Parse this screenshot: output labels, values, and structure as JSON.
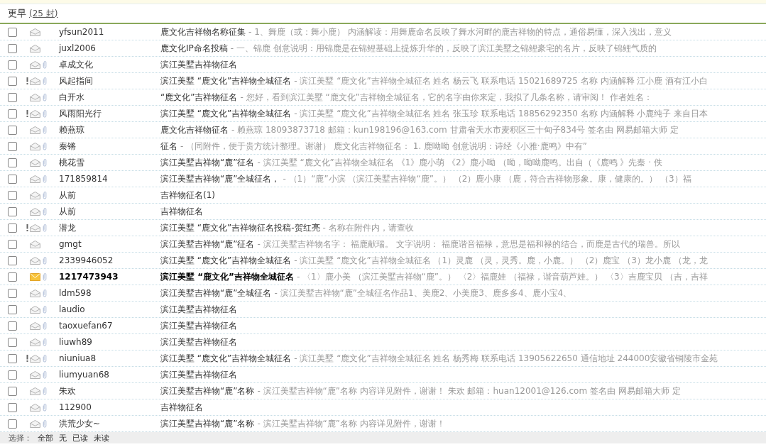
{
  "group": {
    "title": "更早",
    "count": "(25 封)"
  },
  "messages": [
    {
      "sender": "yfsun2011",
      "subject": "鹿文化吉祥物名称征集",
      "preview": "- 1、舞鹿（或：舞小鹿） 内涵解读：用舞鹿命名反映了舞水河畔的鹿吉祥物的特点，通俗易懂，深入浅出，意义",
      "checked": false,
      "flagged": false,
      "unread": false,
      "attachment": false
    },
    {
      "sender": "juxl2006",
      "subject": "鹿文化IP命名投稿",
      "preview": "- 一、锦鹿 创意说明：用锦鹿是在锦鲤基础上提炼升华的，反映了滨江美墅之锦鲤豪宅的名片，反映了锦鲤气质的",
      "checked": false,
      "flagged": false,
      "unread": false,
      "attachment": false
    },
    {
      "sender": "卓成文化",
      "subject": "滨江美墅吉祥物征名",
      "checked": false,
      "flagged": false,
      "unread": false,
      "attachment": true
    },
    {
      "sender": "风起指间",
      "subject": "滨江美墅 “鹿文化”吉祥物全城征名",
      "preview": "-  滨江美墅 “鹿文化”吉祥物全城征名 姓名 杨云飞 联系电话 15021689725 名称 内涵解释 江小鹿 酒有江小白",
      "checked": false,
      "flagged": true,
      "unread": false,
      "attachment": true
    },
    {
      "sender": "白开水",
      "subject": "“鹿文化”吉祥物征名",
      "preview": "- 您好，看到滨江美墅 “鹿文化”吉祥物全城征名，它的名字由你来定，我拟了几条名称，请审阅！ 作者姓名：",
      "checked": false,
      "flagged": false,
      "unread": false,
      "attachment": true
    },
    {
      "sender": "风雨阳光行",
      "subject": "滨江美墅 “鹿文化”吉祥物全城征名",
      "preview": "-  滨江美墅 “鹿文化”吉祥物全城征名 姓名 张玉珍 联系电话 18856292350 名称 内涵解释 小鹿纯子 来自日本",
      "checked": false,
      "flagged": true,
      "unread": false,
      "attachment": true
    },
    {
      "sender": "赖燕琼",
      "subject": "鹿文化吉祥物征名",
      "preview": "-  赖燕琼 18093873718 邮箱：kun198196@163.com 甘肃省天水市麦积区三十甸子834号 签名由 网易邮箱大师 定",
      "checked": false,
      "flagged": false,
      "unread": false,
      "attachment": true
    },
    {
      "sender": "秦锵",
      "subject": "征名",
      "preview": "- （同附件，便于贵方统计整理。谢谢） 鹿文化吉祥物征名： 1. 鹿呦呦 创意说明：诗经《小雅·鹿鸣》中有”",
      "checked": false,
      "flagged": false,
      "unread": false,
      "attachment": true
    },
    {
      "sender": "桃花雪",
      "subject": "滨江美墅吉祥物“鹿”征名",
      "preview": "- 滨江美墅 “鹿文化”吉祥物全城征名 《1》鹿小萌 《2》鹿小呦 （呦，呦呦鹿鸣。出自（《鹿鸣 》先秦 · 佚",
      "checked": false,
      "flagged": false,
      "unread": false,
      "attachment": true
    },
    {
      "sender": "171859814",
      "subject": "滨江美墅吉祥物“鹿”全城征名，",
      "preview": "- （1）“鹿”小滨 （滨江美墅吉祥物“鹿”。） （2）鹿小康 （鹿，符合吉祥物形象。康，健康的。） （3）福",
      "checked": false,
      "flagged": false,
      "unread": false,
      "attachment": true
    },
    {
      "sender": "从前",
      "subject": "吉祥物征名(1)",
      "checked": false,
      "flagged": false,
      "unread": false,
      "attachment": true
    },
    {
      "sender": "从前",
      "subject": "吉祥物征名",
      "checked": false,
      "flagged": false,
      "unread": false,
      "attachment": true
    },
    {
      "sender": "潜龙",
      "subject": "滨江美墅 “鹿文化”吉祥物征名投稿-贺红亮",
      "preview": "- 名称在附件内，请查收",
      "checked": false,
      "flagged": true,
      "unread": false,
      "attachment": true
    },
    {
      "sender": "gmgt",
      "subject": "滨江美墅吉祥物“鹿”征名",
      "preview": "- 滨江美墅吉祥物名字： 福鹿献瑞。 文字说明： 福鹿谐音福禄，意思是福和禄的结合，而鹿是古代的瑞兽。所以",
      "checked": false,
      "flagged": false,
      "unread": false,
      "attachment": false
    },
    {
      "sender": "2339946052",
      "subject": "滨江美墅 “鹿文化”吉祥物全城征名",
      "preview": "- 滨江美墅 “鹿文化”吉祥物全城征名 （1）灵鹿 （灵，灵秀。鹿，小鹿。） （2）鹿宝 （3）龙小鹿 （龙，龙",
      "checked": false,
      "flagged": false,
      "unread": false,
      "attachment": true
    },
    {
      "sender": "1217473943",
      "subject": "滨江美墅 “鹿文化”吉祥物全城征名",
      "preview": "- 〈1〉鹿小美 （滨江美墅吉祥物“鹿”。） 〈2〉福鹿娃 （福禄，谐音葫芦娃。） 〈3〉吉鹿宝贝 （吉，吉祥",
      "checked": false,
      "flagged": false,
      "unread": true,
      "attachment": true
    },
    {
      "sender": "ldm598",
      "subject": "滨江美墅吉祥物“鹿”全城征名",
      "preview": "- 滨江美墅吉祥物“鹿”全城征名作品1、美鹿2、小美鹿3、鹿多多4、鹿小宝4、",
      "checked": false,
      "flagged": false,
      "unread": false,
      "attachment": true
    },
    {
      "sender": "laudio",
      "subject": "滨江美墅吉祥物征名",
      "checked": false,
      "flagged": false,
      "unread": false,
      "attachment": true
    },
    {
      "sender": "taoxuefan67",
      "subject": "滨江美墅吉祥物征名",
      "checked": false,
      "flagged": false,
      "unread": false,
      "attachment": true
    },
    {
      "sender": "liuwh89",
      "subject": "滨江美墅吉祥物征名",
      "checked": false,
      "flagged": false,
      "unread": false,
      "attachment": true
    },
    {
      "sender": "niuniua8",
      "subject": "滨江美墅 “鹿文化”吉祥物全城征名",
      "preview": "-  滨江美墅 “鹿文化”吉祥物全城征名 姓名 杨秀梅 联系电话 13905622650 通信地址 244000安徽省铜陵市金苑",
      "checked": false,
      "flagged": true,
      "unread": false,
      "attachment": true
    },
    {
      "sender": "liumyuan68",
      "subject": "滨江美墅吉祥物征名",
      "checked": false,
      "flagged": false,
      "unread": false,
      "attachment": true
    },
    {
      "sender": "朱欢",
      "subject": "滨江美墅吉祥物“鹿”名称",
      "preview": "-  滨江美墅吉祥物“鹿”名称 内容详见附件，谢谢！ 朱欢 邮箱：huan12001@126.com 签名由 网易邮箱大师 定",
      "checked": false,
      "flagged": false,
      "unread": false,
      "attachment": true
    },
    {
      "sender": "112900",
      "subject": "吉祥物征名",
      "checked": false,
      "flagged": false,
      "unread": false,
      "attachment": true
    },
    {
      "sender": "洪荒少女~",
      "subject": "滨江美墅吉祥物“鹿”名称",
      "preview": "- 滨江美墅吉祥物“鹿”名称 内容详见附件，谢谢！",
      "checked": false,
      "flagged": false,
      "unread": false,
      "attachment": true
    }
  ],
  "footer": {
    "label": "选择：",
    "links": [
      "全部",
      "无",
      "已读",
      "未读"
    ]
  }
}
